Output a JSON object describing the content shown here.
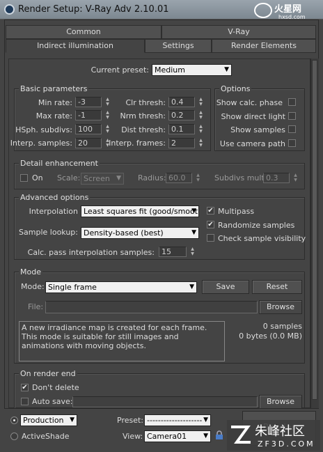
{
  "window": {
    "title": "Render Setup: V-Ray Adv 2.10.01"
  },
  "watermark_top": {
    "site": "hxsd.com",
    "brand": "火星网"
  },
  "tabs_row1": [
    "Common",
    "V-Ray"
  ],
  "tabs_row2": [
    "Indirect illumination",
    "Settings",
    "Render Elements"
  ],
  "preset": {
    "label": "Current preset:",
    "value": "Medium"
  },
  "basic": {
    "title": "Basic parameters",
    "min_rate_label": "Min rate:",
    "min_rate": "-3",
    "max_rate_label": "Max rate:",
    "max_rate": "-1",
    "hsph_label": "HSph. subdivs:",
    "hsph": "100",
    "interp_samples_label": "Interp. samples:",
    "interp_samples": "20",
    "clr_label": "Clr thresh:",
    "clr": "0.4",
    "nrm_label": "Nrm thresh:",
    "nrm": "0.2",
    "dist_label": "Dist thresh:",
    "dist": "0.1",
    "interp_frames_label": "Interp. frames:",
    "interp_frames": "2"
  },
  "options": {
    "title": "Options",
    "show_calc": "Show calc. phase",
    "show_direct": "Show direct light",
    "show_samples": "Show samples",
    "use_camera": "Use camera path"
  },
  "detail": {
    "title": "Detail enhancement",
    "on_label": "On",
    "scale_label": "Scale:",
    "scale_value": "Screen",
    "radius_label": "Radius:",
    "radius": "60.0",
    "subdivs_label": "Subdivs mult.",
    "subdivs": "0.3"
  },
  "advanced": {
    "title": "Advanced options",
    "interp_label": "Interpolation",
    "interp_value": "Least squares fit (good/smooth",
    "lookup_label": "Sample lookup:",
    "lookup_value": "Density-based (best)",
    "calc_pass_label": "Calc. pass interpolation samples:",
    "calc_pass": "15",
    "multipass": "Multipass",
    "randomize": "Randomize samples",
    "check_vis": "Check sample visibility"
  },
  "mode": {
    "title": "Mode",
    "mode_label": "Mode:",
    "mode_value": "Single frame",
    "save": "Save",
    "reset": "Reset",
    "file_label": "File:",
    "browse": "Browse",
    "description": "A new irradiance map is created for each frame.\nThis mode is suitable for still images and animations with moving objects.",
    "samples": "0 samples",
    "bytes": "0 bytes (0.0 MB)"
  },
  "render_end": {
    "title": "On render end",
    "dont_delete": "Don't delete",
    "auto_save": "Auto save:",
    "browse": "Browse"
  },
  "bottom": {
    "production": "Production",
    "activeshade": "ActiveShade",
    "preset_label": "Preset:",
    "preset_value": "--------------------",
    "view_label": "View:",
    "view_value": "Camera01",
    "render": "Render"
  },
  "watermark_bottom": {
    "brand": "朱峰社区",
    "site": "ZF3D.COM"
  }
}
